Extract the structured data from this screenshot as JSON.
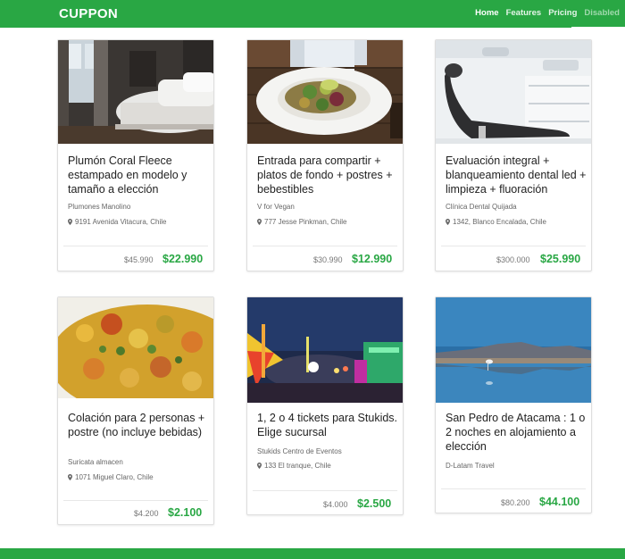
{
  "brand": "CUPPON",
  "nav": {
    "home": "Home",
    "features": "Features",
    "pricing": "Pricing",
    "disabled": "Disabled"
  },
  "cards": [
    {
      "title": "Plumón Coral Fleece estampado en modelo y tamaño a elección",
      "merchant": "Plumones Manolino",
      "location": "9191 Avenida Vitacura, Chile",
      "old_price": "$45.990",
      "new_price": "$22.990",
      "image": "bedroom"
    },
    {
      "title": "Entrada para compartir + platos de fondo + postres + bebestibles",
      "merchant": "V for Vegan",
      "location": "777 Jesse Pinkman, Chile",
      "old_price": "$30.990",
      "new_price": "$12.990",
      "image": "salad-plate"
    },
    {
      "title": "Evaluación integral + blanqueamiento dental led + limpieza + fluoración",
      "merchant": "Clínica Dental Quijada",
      "location": "1342, Blanco Encalada, Chile",
      "old_price": "$300.000",
      "new_price": "$25.990",
      "image": "dental-chair"
    },
    {
      "title": "Colación para 2 personas + postre (no incluye bebidas)",
      "merchant": "Suricata almacen",
      "location": "1071 Miguel Claro, Chile",
      "old_price": "$4.200",
      "new_price": "$2.100",
      "image": "vegetable-stew"
    },
    {
      "title": "1, 2 o 4 tickets para Stukids. Elige sucursal",
      "merchant": "Stukids Centro de Eventos",
      "location": "133 El tranque, Chile",
      "old_price": "$4.000",
      "new_price": "$2.500",
      "image": "amusement-park"
    },
    {
      "title": "San Pedro de Atacama : 1 o 2 noches en alojamiento a elección",
      "merchant": "D-Latam Travel",
      "location": "",
      "old_price": "$80.200",
      "new_price": "$44.100",
      "image": "lagoon-flamingo"
    }
  ]
}
